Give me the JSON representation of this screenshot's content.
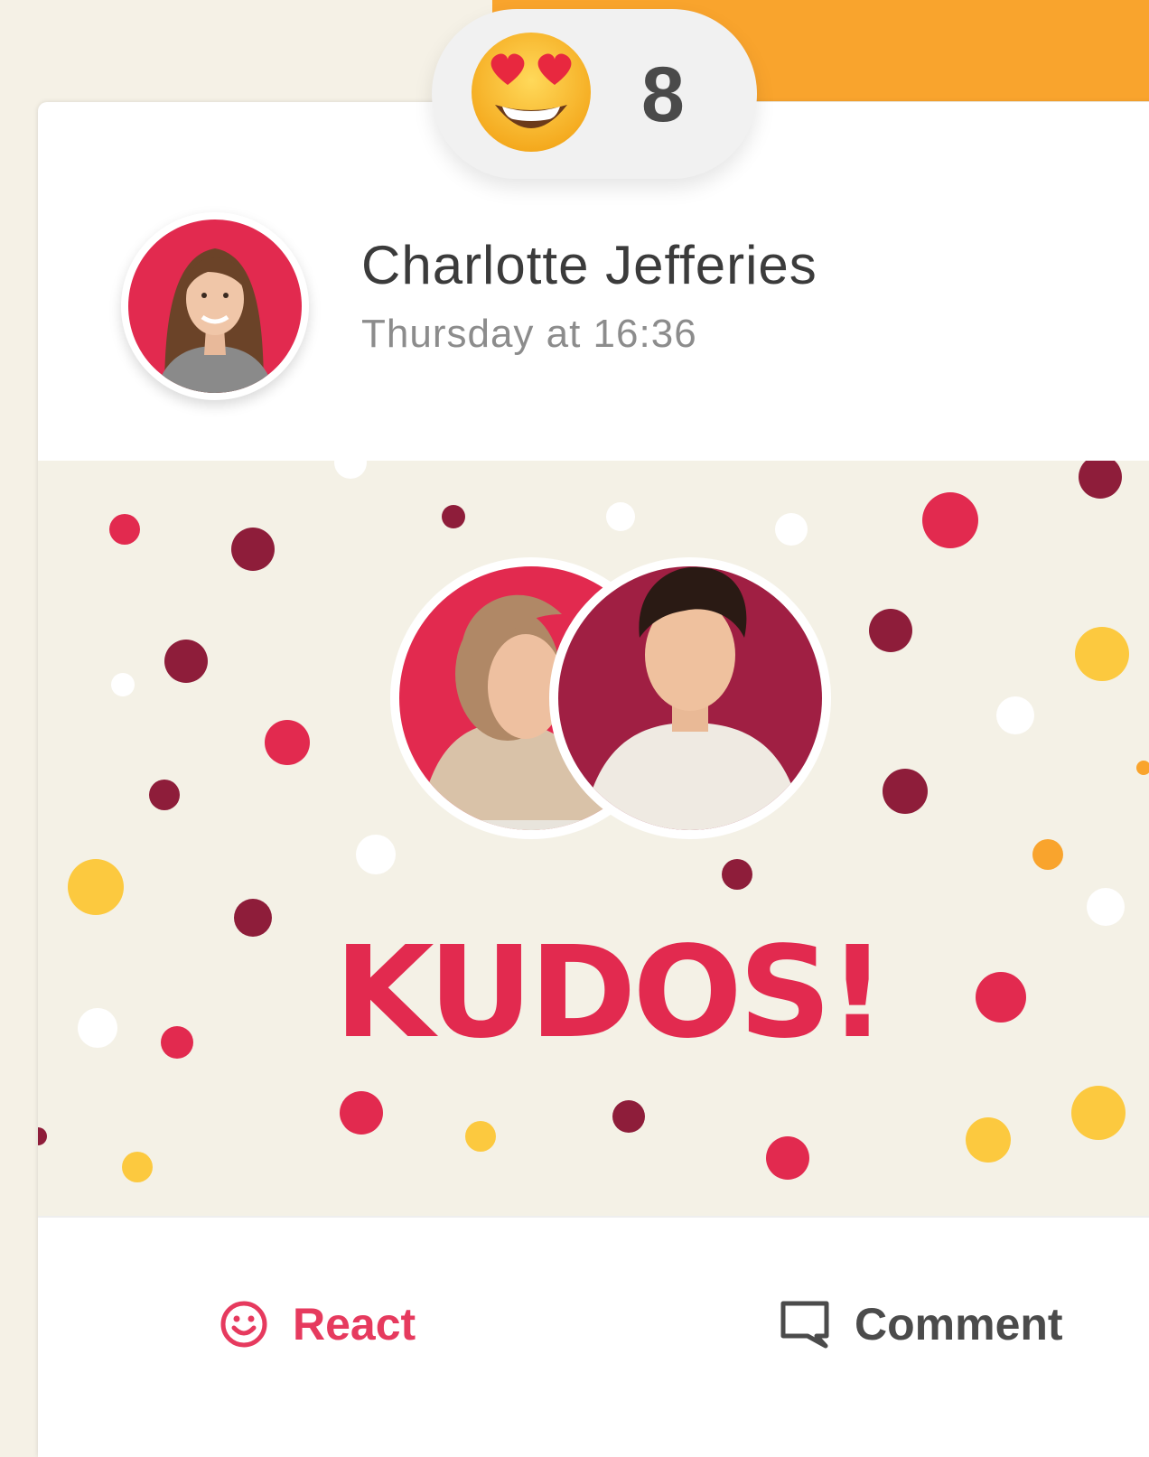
{
  "reaction": {
    "emoji": "heart-eyes-emoji",
    "count": "8"
  },
  "post": {
    "author_name": "Charlotte Jefferies",
    "timestamp": "Thursday at 16:36",
    "banner_text": "KUDOS!"
  },
  "actions": {
    "react_label": "React",
    "comment_label": "Comment"
  },
  "colors": {
    "accent_pink": "#e22a4f",
    "maroon": "#8e1d3a",
    "yellow": "#fcc93f",
    "orange": "#f9a42d",
    "banner_bg": "#f4f1e6"
  }
}
